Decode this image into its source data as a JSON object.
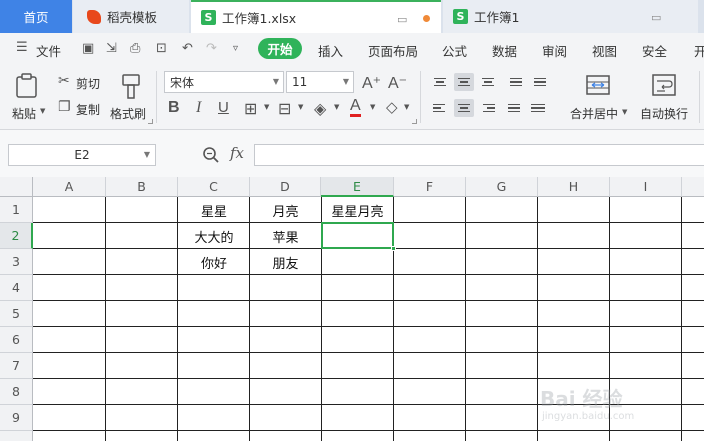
{
  "tabs": {
    "home": "首页",
    "template": "稻壳模板",
    "active_doc": "工作簿1.xlsx",
    "second_doc": "工作簿1"
  },
  "menu": {
    "file": "文件",
    "items": [
      "开始",
      "插入",
      "页面布局",
      "公式",
      "数据",
      "审阅",
      "视图",
      "安全",
      "开"
    ]
  },
  "ribbon": {
    "paste": "粘贴",
    "cut": "剪切",
    "copy": "复制",
    "format_painter": "格式刷",
    "font_name": "宋体",
    "font_size": "11",
    "merge_center": "合并居中",
    "wrap_text": "自动换行"
  },
  "formula_bar": {
    "cell_ref": "E2",
    "fx_label": "fx",
    "formula": ""
  },
  "sheet": {
    "columns": [
      "A",
      "B",
      "C",
      "D",
      "E",
      "F",
      "G",
      "H",
      "I"
    ],
    "rows": [
      "1",
      "2",
      "3",
      "4",
      "5",
      "6",
      "7",
      "8",
      "9"
    ],
    "selected_cell": "E2",
    "cells": {
      "C1": "星星",
      "D1": "月亮",
      "E1": "星星月亮",
      "C2": "大大的",
      "D2": "苹果",
      "C3": "你好",
      "D3": "朋友"
    }
  },
  "watermark": {
    "brand": "Bai 经验",
    "url": "jingyan.baidu.com"
  },
  "colors": {
    "accent_green": "#2fb35a",
    "home_tab_blue": "#3f83e6",
    "selection_green": "#2fa84f"
  }
}
